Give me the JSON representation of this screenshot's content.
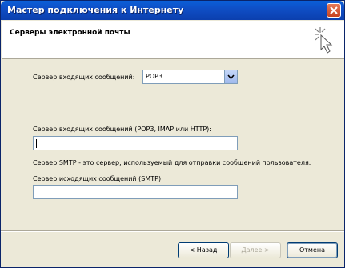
{
  "window": {
    "title": "Мастер подключения к Интернету"
  },
  "header": {
    "title": "Серверы электронной почты"
  },
  "form": {
    "incoming_type_label": "Сервер входящих сообщений:",
    "incoming_type_value": "POP3",
    "incoming_server_label": "Сервер входящих сообщений (POP3, IMAP или HTTP):",
    "incoming_server_value": "",
    "smtp_note": "Сервер SMTP - это сервер, используемый для отправки сообщений пользователя.",
    "outgoing_server_label": "Сервер исходящих сообщений (SMTP):",
    "outgoing_server_value": ""
  },
  "buttons": {
    "back": "< Назад",
    "next": "Далее >",
    "cancel": "Отмена"
  },
  "icons": {
    "close": "close-icon",
    "dropdown": "chevron-down-icon",
    "wizard": "wizard-sparkle-cursor-icon"
  }
}
